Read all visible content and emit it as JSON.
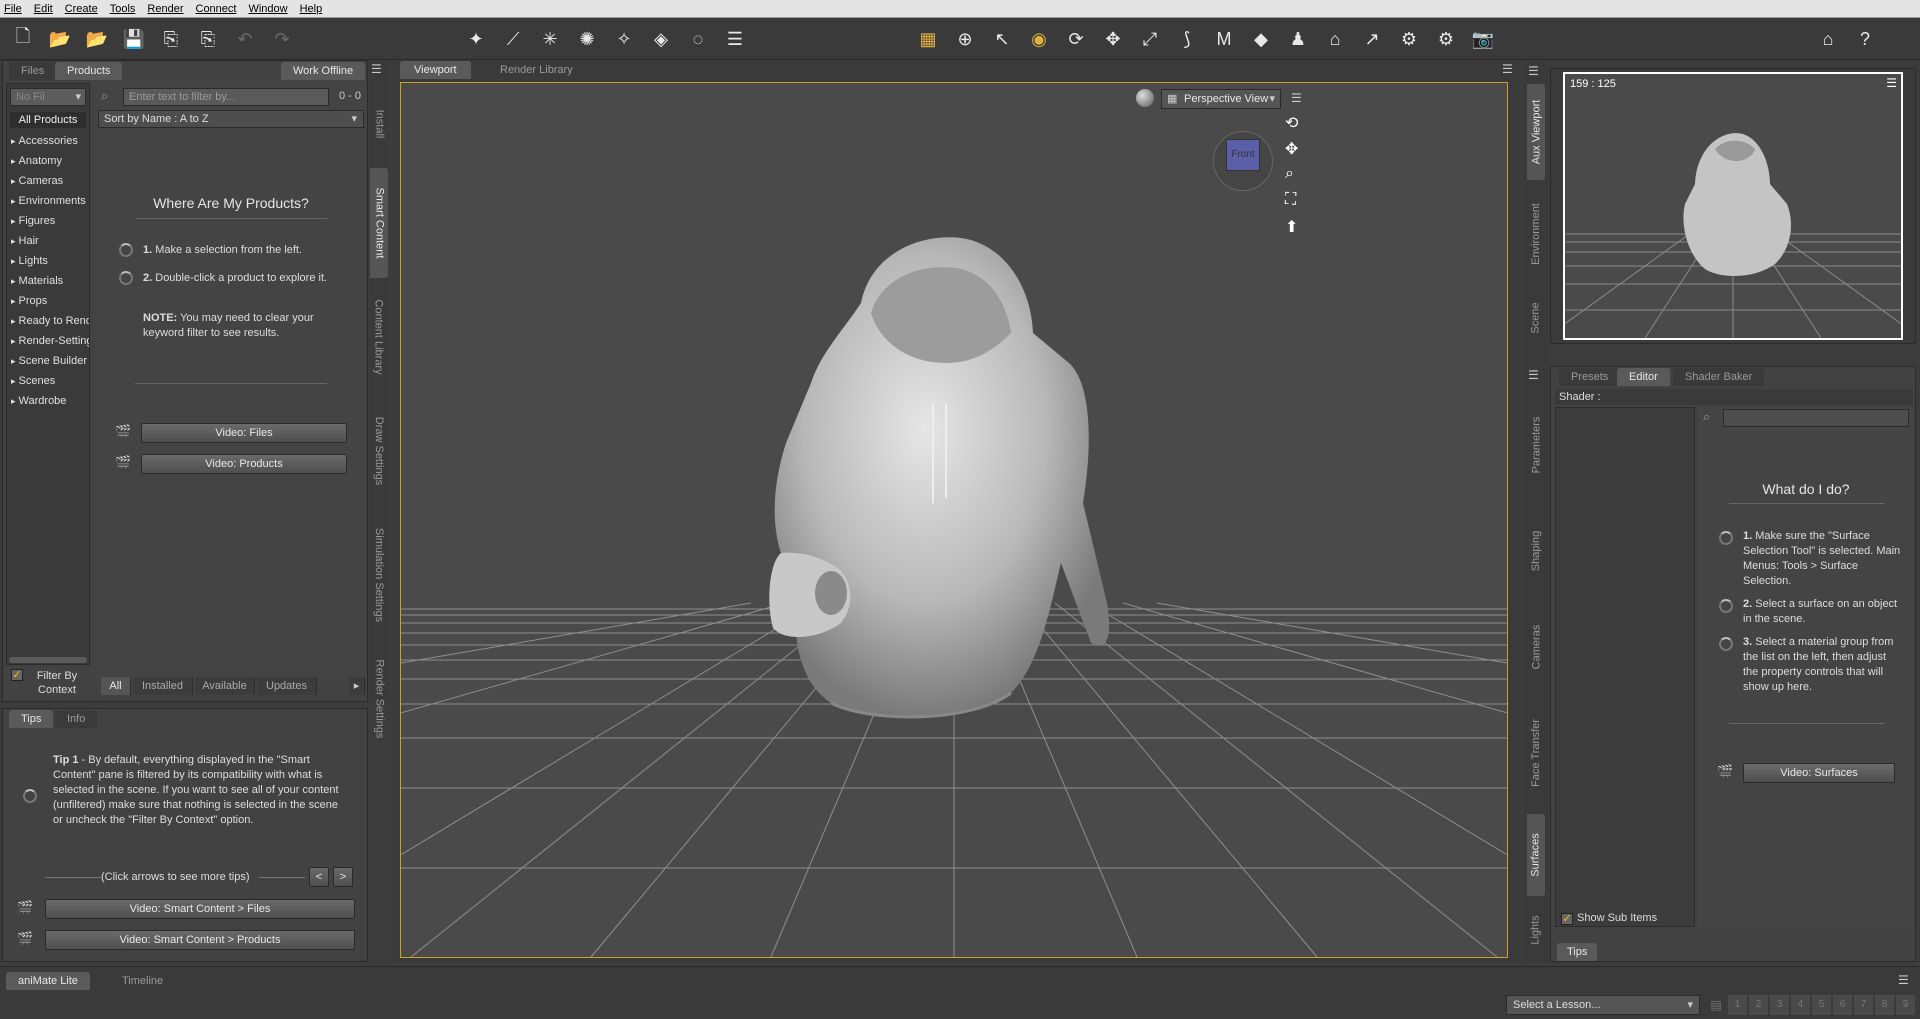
{
  "menu": [
    "File",
    "Edit",
    "Create",
    "Tools",
    "Render",
    "Connect",
    "Window",
    "Help"
  ],
  "content_panel": {
    "tabs": [
      "Files",
      "Products"
    ],
    "active_tab": "Products",
    "work_offline": "Work Offline",
    "filter_dropdown": "No Fil",
    "search_placeholder": "Enter text to filter by...",
    "count": "0 - 0",
    "sort": "Sort by Name : A to Z",
    "all_products": "All Products",
    "categories": [
      "Accessories",
      "Anatomy",
      "Cameras",
      "Environments",
      "Figures",
      "Hair",
      "Lights",
      "Materials",
      "Props",
      "Ready to Render",
      "Render-Settings",
      "Scene Builder",
      "Scenes",
      "Wardrobe"
    ],
    "heading": "Where Are My Products?",
    "step1_num": "1.",
    "step1": "Make a selection from the left.",
    "step2_num": "2.",
    "step2": "Double-click a product to explore it.",
    "note_label": "NOTE:",
    "note": "You may need to clear your keyword filter to see results.",
    "video_files": "Video: Files",
    "video_products": "Video: Products",
    "filter_by_context": "Filter By Context",
    "bottom_tabs": [
      "All",
      "Installed",
      "Available",
      "Updates"
    ],
    "vtabs": [
      "Install",
      "Smart Content",
      "Content Library",
      "Draw Settings",
      "Simulation Settings",
      "Render Settings"
    ]
  },
  "tips_panel": {
    "tabs": [
      "Tips",
      "Info"
    ],
    "tip_label": "Tip 1",
    "tip_text": "- By default, everything displayed in the \"Smart Content\" pane is filtered by its compatibility with what is selected in the scene. If you want to see all of your content (unfiltered) make sure that nothing is selected in the scene or uncheck the \"Filter By Context\" option.",
    "nav_hint": "(Click arrows to see more tips)",
    "prev": "<",
    "next": ">",
    "video_sc_files": "Video: Smart Content > Files",
    "video_sc_products": "Video: Smart Content > Products"
  },
  "viewport": {
    "tabs": [
      "Viewport",
      "Render Library"
    ],
    "view_select": "Perspective View",
    "cube_label": "Front"
  },
  "aux_viewport": {
    "coords": "159 : 125",
    "vtabs": [
      "Aux Viewport",
      "Environment",
      "Scene"
    ]
  },
  "surfaces_panel": {
    "tabs": [
      "Presets",
      "Editor",
      "Shader Baker"
    ],
    "active_tab": "Editor",
    "shader_label": "Shader :",
    "heading": "What do I do?",
    "step1_num": "1.",
    "step1": "Make sure the \"Surface Selection Tool\" is selected. Main Menus: Tools > Surface Selection.",
    "step2_num": "2.",
    "step2": "Select a surface on an object in the scene.",
    "step3_num": "3.",
    "step3": "Select a material group from the list on the left, then adjust the property controls that will show up here.",
    "video_surfaces": "Video: Surfaces",
    "show_sub_items": "Show Sub Items",
    "tips_tab": "Tips",
    "vtabs": [
      "Parameters",
      "Shaping",
      "Cameras",
      "Face Transfer",
      "Surfaces",
      "Lights"
    ]
  },
  "timeline": {
    "tabs": [
      "aniMate Lite",
      "Timeline"
    ],
    "lesson_select": "Select a Lesson...",
    "lesson_pages": [
      "1",
      "2",
      "3",
      "4",
      "5",
      "6",
      "7",
      "8",
      "9"
    ]
  },
  "colors": {
    "viewport_border": "#c9a227",
    "accent": "#e0b040",
    "panel": "#444444"
  }
}
